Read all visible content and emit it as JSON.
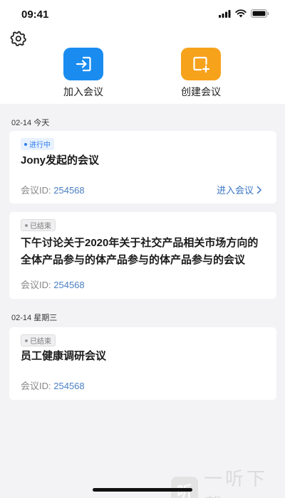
{
  "status_bar": {
    "time": "09:41"
  },
  "actions": {
    "join_label": "加入会议",
    "create_label": "创建会议"
  },
  "sections": [
    {
      "date": "02-14",
      "day": "今天",
      "meetings": [
        {
          "status": "进行中",
          "title": "Jony发起的会议",
          "id_label": "会议ID:",
          "id_value": "254568",
          "enter_label": "进入会议"
        },
        {
          "status": "已结束",
          "title": "下午讨论关于2020年关于社交产品相关市场方向的全体产品参与的体产品参与的体产品参与的会议",
          "id_label": "会议ID:",
          "id_value": "254568"
        }
      ]
    },
    {
      "date": "02-14",
      "day": "星期三",
      "meetings": [
        {
          "status": "已结束",
          "title": "员工健康调研会议",
          "id_label": "会议ID:",
          "id_value": "254568"
        }
      ]
    }
  ],
  "watermark": {
    "logo_char": "听",
    "text": "一听下载"
  },
  "colors": {
    "join": "#1a8cf0",
    "create": "#f7a21b",
    "ongoing": "#2f7ef0",
    "link": "#3a75c4"
  },
  "icons": {
    "settings": "gear-icon",
    "join": "enter-icon",
    "create": "add-window-icon",
    "enter_arrow": "chevron-right-icon"
  }
}
